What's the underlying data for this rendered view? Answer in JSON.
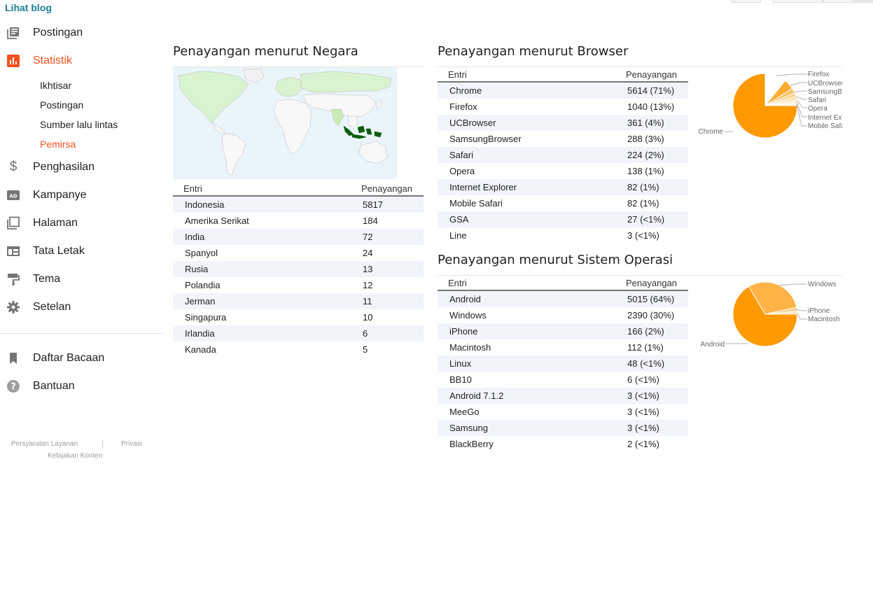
{
  "sidebar": {
    "view_blog": "Lihat blog",
    "items": [
      {
        "label": "Postingan"
      },
      {
        "label": "Statistik"
      },
      {
        "label": "Penghasilan"
      },
      {
        "label": "Kampanye"
      },
      {
        "label": "Halaman"
      },
      {
        "label": "Tata Letak"
      },
      {
        "label": "Tema"
      },
      {
        "label": "Setelan"
      },
      {
        "label": "Daftar Bacaan"
      },
      {
        "label": "Bantuan"
      }
    ],
    "sub_items": [
      {
        "label": "Ikhtisar"
      },
      {
        "label": "Postingan"
      },
      {
        "label": "Sumber lalu lintas"
      },
      {
        "label": "Pemirsa"
      }
    ],
    "footer": {
      "terms": "Persyaratan Layanan",
      "privacy": "Privasi",
      "content_policy": "Kebijakan Konten"
    }
  },
  "colors": {
    "accent": "#f4511e",
    "link": "#1e7d94",
    "pie_main": "#ff9900",
    "pie_light": "#ffb54c"
  },
  "country": {
    "title": "Penayangan menurut Negara",
    "col_entry": "Entri",
    "col_views": "Penayangan",
    "rows": [
      {
        "name": "Indonesia",
        "views": "5817"
      },
      {
        "name": "Amerika Serikat",
        "views": "184"
      },
      {
        "name": "India",
        "views": "72"
      },
      {
        "name": "Spanyol",
        "views": "24"
      },
      {
        "name": "Rusia",
        "views": "13"
      },
      {
        "name": "Polandia",
        "views": "12"
      },
      {
        "name": "Jerman",
        "views": "11"
      },
      {
        "name": "Singapura",
        "views": "10"
      },
      {
        "name": "Irlandia",
        "views": "6"
      },
      {
        "name": "Kanada",
        "views": "5"
      }
    ]
  },
  "browser": {
    "title": "Penayangan menurut Browser",
    "col_entry": "Entri",
    "col_views": "Penayangan",
    "rows": [
      {
        "name": "Chrome",
        "views": "5614 (71%)"
      },
      {
        "name": "Firefox",
        "views": "1040 (13%)"
      },
      {
        "name": "UCBrowser",
        "views": "361 (4%)"
      },
      {
        "name": "SamsungBrowser",
        "views": "288 (3%)"
      },
      {
        "name": "Safari",
        "views": "224 (2%)"
      },
      {
        "name": "Opera",
        "views": "138 (1%)"
      },
      {
        "name": "Internet Explorer",
        "views": "82 (1%)"
      },
      {
        "name": "Mobile Safari",
        "views": "82 (1%)"
      },
      {
        "name": "GSA",
        "views": "27 (<1%)"
      },
      {
        "name": "Line",
        "views": "3 (<1%)"
      }
    ],
    "pie_labels": {
      "chrome": "Chrome",
      "firefox": "Firefox",
      "ucbrowser": "UCBrowser",
      "samsung": "SamsungBrowser",
      "safari": "Safari",
      "opera": "Opera",
      "ie": "Internet Explorer",
      "mobile_safari": "Mobile Safari"
    }
  },
  "os": {
    "title": "Penayangan menurut Sistem Operasi",
    "col_entry": "Entri",
    "col_views": "Penayangan",
    "rows": [
      {
        "name": "Android",
        "views": "5015 (64%)"
      },
      {
        "name": "Windows",
        "views": "2390 (30%)"
      },
      {
        "name": "iPhone",
        "views": "166 (2%)"
      },
      {
        "name": "Macintosh",
        "views": "112 (1%)"
      },
      {
        "name": "Linux",
        "views": "48 (<1%)"
      },
      {
        "name": "BB10",
        "views": "6 (<1%)"
      },
      {
        "name": "Android 7.1.2",
        "views": "3 (<1%)"
      },
      {
        "name": "MeeGo",
        "views": "3 (<1%)"
      },
      {
        "name": "Samsung",
        "views": "3 (<1%)"
      },
      {
        "name": "BlackBerry",
        "views": "2 (<1%)"
      }
    ],
    "pie_labels": {
      "android": "Android",
      "windows": "Windows",
      "iphone": "iPhone",
      "macintosh": "Macintosh"
    }
  }
}
